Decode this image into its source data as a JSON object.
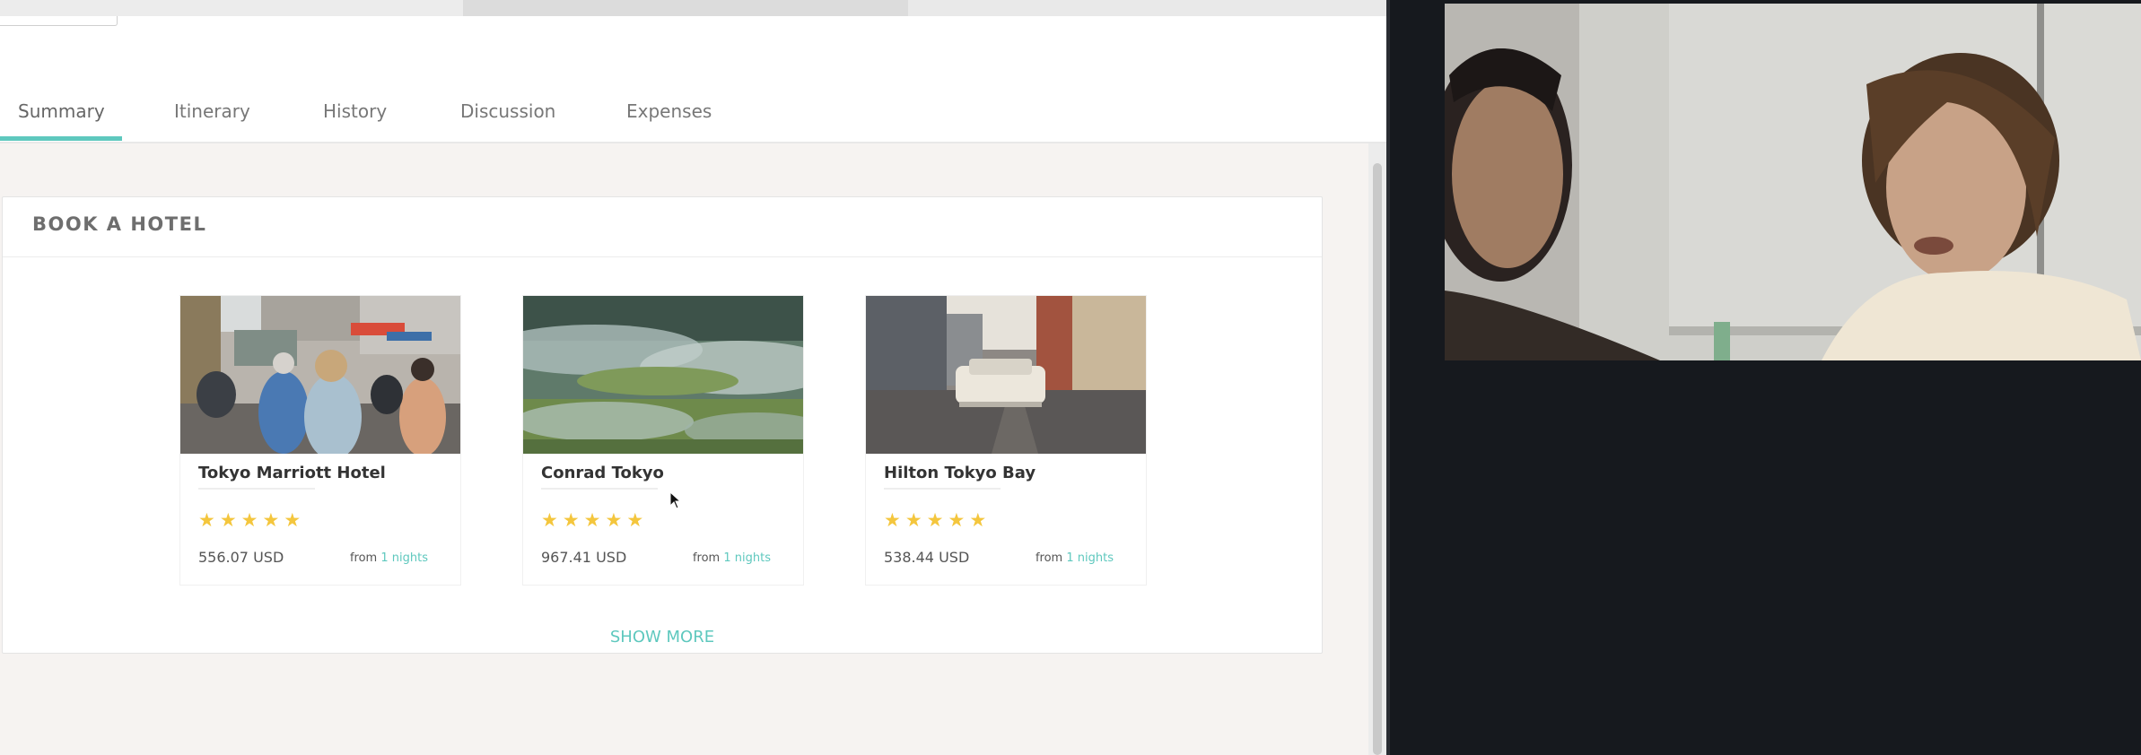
{
  "tabs": [
    {
      "label": "Summary",
      "active": true
    },
    {
      "label": "Itinerary",
      "active": false
    },
    {
      "label": "History",
      "active": false
    },
    {
      "label": "Discussion",
      "active": false
    },
    {
      "label": "Expenses",
      "active": false
    }
  ],
  "book_hotel": {
    "title": "BOOK A HOTEL",
    "show_more": "SHOW MORE",
    "hotels": [
      {
        "name": "Tokyo Marriott Hotel",
        "rating": 5,
        "price": "556.07 USD",
        "nights_prefix": "from",
        "nights_link": "1 nights"
      },
      {
        "name": "Conrad Tokyo",
        "rating": 5,
        "price": "967.41 USD",
        "nights_prefix": "from",
        "nights_link": "1 nights"
      },
      {
        "name": "Hilton Tokyo Bay",
        "rating": 5,
        "price": "538.44 USD",
        "nights_prefix": "from",
        "nights_link": "1 nights"
      }
    ]
  },
  "icons": {
    "star": "star-icon",
    "cursor": "mouse-pointer-icon"
  },
  "colors": {
    "accent": "#5ec8be",
    "star": "#f4c63d",
    "app_bg": "#f6f3f1",
    "call_bg": "#16191e"
  }
}
